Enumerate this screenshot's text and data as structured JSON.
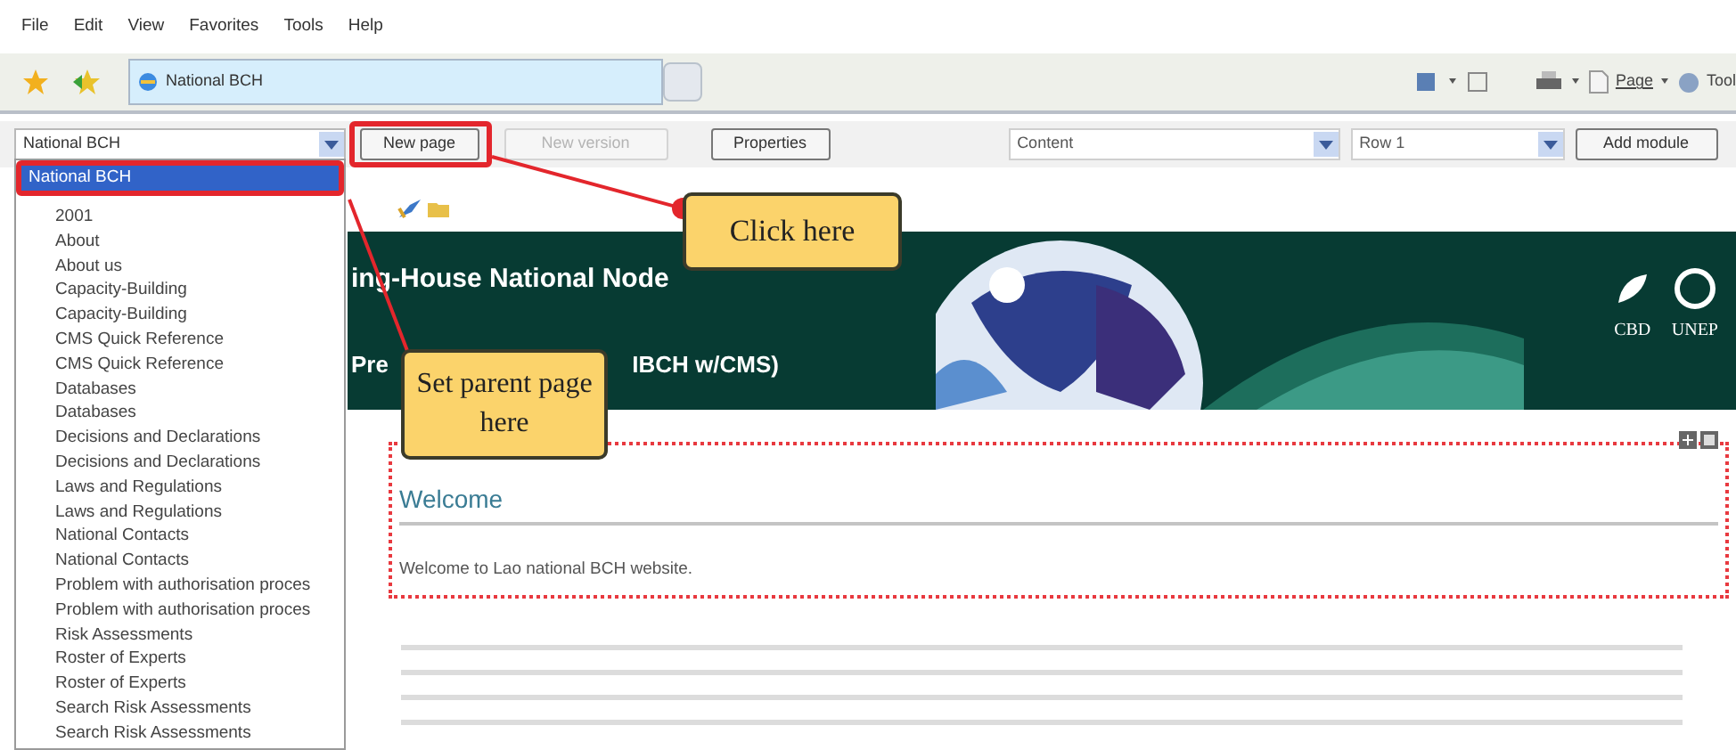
{
  "menu": [
    {
      "label": "File"
    },
    {
      "label": "Edit"
    },
    {
      "label": "View"
    },
    {
      "label": "Favorites"
    },
    {
      "label": "Tools"
    },
    {
      "label": "Help"
    }
  ],
  "tab": {
    "title": "National BCH"
  },
  "browser_toolbar": {
    "page": "Page",
    "tools": "Tool"
  },
  "cms_toolbar": {
    "parent_select": "National BCH",
    "buttons": [
      {
        "label": "New page",
        "disabled": false
      },
      {
        "label": "New version",
        "disabled": true
      },
      {
        "label": "Properties",
        "disabled": false
      }
    ],
    "pane_select": "Content",
    "row_select": "Row 1",
    "add_button": "Add module"
  },
  "parent_list": [
    {
      "label": "National BCH",
      "selected": true,
      "children": [
        {
          "label": "2001",
          "selected": false
        },
        {
          "label": "About",
          "selected": false
        },
        {
          "label": "About us",
          "selected": false
        },
        {
          "label": "Capacity-Building",
          "selected": false
        },
        {
          "label": "Capacity-Building",
          "selected": false
        },
        {
          "label": "CMS Quick Reference",
          "selected": false
        },
        {
          "label": "CMS Quick Reference",
          "selected": false
        },
        {
          "label": "Databases",
          "selected": false
        },
        {
          "label": "Databases",
          "selected": false
        },
        {
          "label": "Decisions and Declarations",
          "selected": false
        },
        {
          "label": "Decisions and Declarations",
          "selected": false
        },
        {
          "label": "Laws and Regulations",
          "selected": false
        },
        {
          "label": "Laws and Regulations",
          "selected": false
        },
        {
          "label": "National Contacts",
          "selected": false
        },
        {
          "label": "National Contacts",
          "selected": false
        },
        {
          "label": "Problem with authorisation proces",
          "selected": false
        },
        {
          "label": "Problem with authorisation proces",
          "selected": false
        },
        {
          "label": "Risk Assessments",
          "selected": false
        },
        {
          "label": "Roster of Experts",
          "selected": false
        },
        {
          "label": "Roster of Experts",
          "selected": false
        },
        {
          "label": "Search Risk Assessments",
          "selected": false
        },
        {
          "label": "Search Risk Assessments",
          "selected": false
        }
      ]
    }
  ],
  "banner": {
    "title": "ing-House National Node",
    "subtitle_start": "Pre",
    "subtitle_end": "IBCH w/CMS)",
    "logos": [
      {
        "label": "CBD"
      },
      {
        "label": "UNEP"
      }
    ]
  },
  "module": {
    "title": "Welcome",
    "body": "Welcome to Lao national BCH website."
  },
  "callouts": [
    {
      "text": "Click here"
    },
    {
      "text": "Set parent page here"
    }
  ]
}
